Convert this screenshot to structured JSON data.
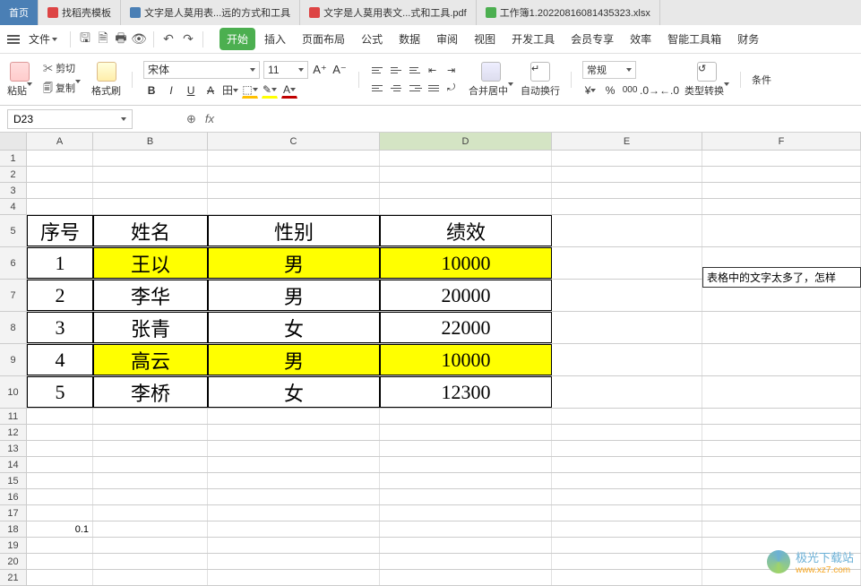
{
  "tabs": {
    "home": "首页",
    "template": "找稻壳模板",
    "doc": "文字是人莫用表...远的方式和工具",
    "pdf": "文字是人莫用表文...式和工具.pdf",
    "xls": "工作簿1.20220816081435323.xlsx"
  },
  "menu": {
    "file": "文件",
    "tabs": {
      "start": "开始",
      "insert": "插入",
      "layout": "页面布局",
      "formula": "公式",
      "data": "数据",
      "review": "审阅",
      "view": "视图",
      "dev": "开发工具",
      "member": "会员专享",
      "efficiency": "效率",
      "smart": "智能工具箱",
      "finance": "财务"
    }
  },
  "ribbon": {
    "paste": "粘贴",
    "cut": "剪切",
    "copy": "复制",
    "format_painter": "格式刷",
    "font_name": "宋体",
    "font_size": "11",
    "merge": "合并居中",
    "wrap": "自动换行",
    "number_format": "常规",
    "type_convert": "类型转换",
    "cond": "条件"
  },
  "namebox": {
    "value": "D23"
  },
  "columns": [
    "A",
    "B",
    "C",
    "D",
    "E",
    "F"
  ],
  "table": {
    "headers": {
      "seq": "序号",
      "name": "姓名",
      "gender": "性别",
      "perf": "绩效"
    },
    "rows": [
      {
        "seq": "1",
        "name": "王以",
        "gender": "男",
        "perf": "10000",
        "hl": true
      },
      {
        "seq": "2",
        "name": "李华",
        "gender": "男",
        "perf": "20000",
        "hl": false
      },
      {
        "seq": "3",
        "name": "张青",
        "gender": "女",
        "perf": "22000",
        "hl": false
      },
      {
        "seq": "4",
        "name": "高云",
        "gender": "男",
        "perf": "10000",
        "hl": true
      },
      {
        "seq": "5",
        "name": "李桥",
        "gender": "女",
        "perf": "12300",
        "hl": false
      }
    ]
  },
  "comment": "表格中的文字太多了，怎样",
  "cell_a18": "0.1",
  "watermark": {
    "title": "极光下载站",
    "url": "www.xz7.com"
  }
}
